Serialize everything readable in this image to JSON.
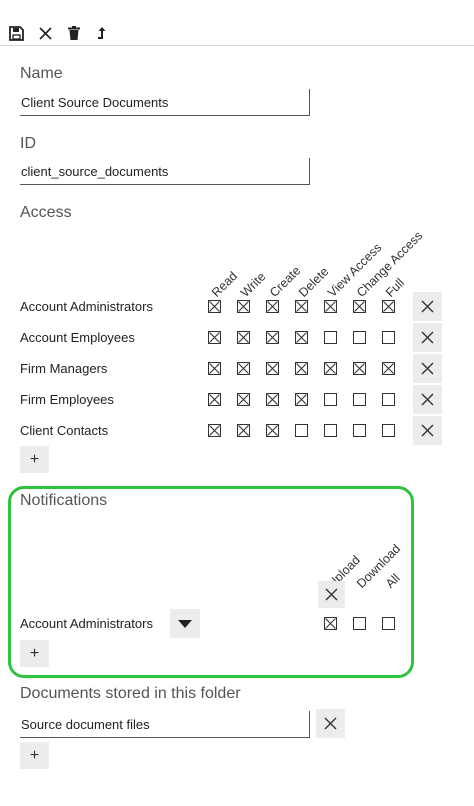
{
  "toolbar": {
    "save_icon": "save-icon",
    "close_icon": "close-icon",
    "delete_icon": "trash-icon",
    "move_icon": "move-up-icon"
  },
  "name": {
    "label": "Name",
    "value": "Client Source Documents"
  },
  "id": {
    "label": "ID",
    "value": "client_source_documents"
  },
  "access": {
    "label": "Access",
    "columns": [
      "Read",
      "Write",
      "Create",
      "Delete",
      "View Access",
      "Change Access",
      "Full"
    ],
    "rows": [
      {
        "name": "Account Administrators",
        "checks": [
          true,
          true,
          true,
          true,
          true,
          true,
          true
        ]
      },
      {
        "name": "Account Employees",
        "checks": [
          true,
          true,
          true,
          true,
          false,
          false,
          false
        ]
      },
      {
        "name": "Firm Managers",
        "checks": [
          true,
          true,
          true,
          true,
          true,
          true,
          true
        ]
      },
      {
        "name": "Firm Employees",
        "checks": [
          true,
          true,
          true,
          true,
          false,
          false,
          false
        ]
      },
      {
        "name": "Client Contacts",
        "checks": [
          true,
          true,
          true,
          false,
          false,
          false,
          false
        ]
      }
    ],
    "add_label": "+"
  },
  "notifications": {
    "label": "Notifications",
    "columns": [
      "Upload",
      "Download",
      "All"
    ],
    "rows": [
      {
        "name": "Account Administrators",
        "checks": [
          true,
          false,
          false
        ]
      }
    ],
    "add_label": "+",
    "highlight_color": "#2fc23f"
  },
  "documents": {
    "label": "Documents stored in this folder",
    "value": "Source document files",
    "add_label": "+"
  }
}
